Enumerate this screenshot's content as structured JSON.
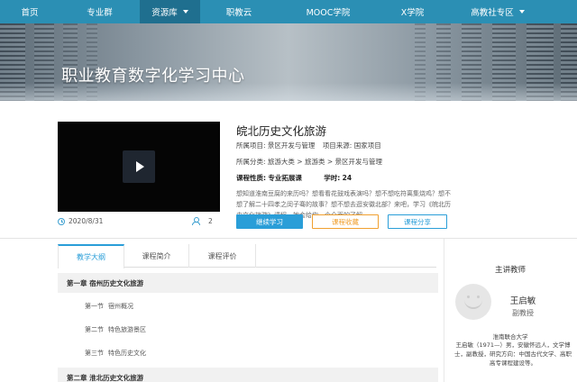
{
  "nav": {
    "items": [
      {
        "label": "首页",
        "dropdown": false
      },
      {
        "label": "专业群",
        "dropdown": false
      },
      {
        "label": "资源库",
        "dropdown": true
      },
      {
        "label": "职教云",
        "dropdown": false
      },
      {
        "label": "MOOC学院",
        "dropdown": false
      },
      {
        "label": "X学院",
        "dropdown": false
      },
      {
        "label": "高教社专区",
        "dropdown": true
      }
    ],
    "active_index": 2
  },
  "banner": {
    "title": "职业教育数字化学习中心"
  },
  "video": {
    "date": "2020/8/31",
    "learners": "2"
  },
  "course": {
    "title": "皖北历史文化旅游",
    "project_label": "所属项目:",
    "project": "景区开发与管理",
    "source_label": "项目来源:",
    "source": "国家项目",
    "category_label": "所属分类:",
    "category_path": "旅游大类 > 旅游类 > 景区开发与管理",
    "nature_label": "课程性质:",
    "nature": "专业拓展课",
    "hours_label": "学时:",
    "hours": "24",
    "description": "想知道淮南豆腐的来历吗？想看看花鼓戏表演吗？想不想吃符离集烧鸡？想不想了解二十四孝之闵子骞的故事？想不想去逛安徽北部？来吧，学习《皖北历史文化旅游》课程，她会给你一个全面的了解。"
  },
  "actions": {
    "study": "继续学习",
    "favorite": "课程收藏",
    "share": "课程分享"
  },
  "tabs": [
    {
      "label": "教学大纲",
      "active": true
    },
    {
      "label": "课程简介",
      "active": false
    },
    {
      "label": "课程评价",
      "active": false
    }
  ],
  "syllabus": {
    "chapter1": {
      "title": "第一章 宿州历史文化旅游",
      "sections": [
        {
          "num": "第一节",
          "name": "宿州概况"
        },
        {
          "num": "第二节",
          "name": "特色旅游景区"
        },
        {
          "num": "第三节",
          "name": "特色历史文化"
        }
      ]
    },
    "chapter2": {
      "title": "第二章 淮北历史文化旅游"
    }
  },
  "teacher": {
    "section_title": "主讲教师",
    "name": "王启敏",
    "title": "副教授",
    "org": "淮南联合大学",
    "bio": "王启敏（1971—）男，安徽怀远人，文学博士，副教授，研究方向：中国古代文学、高职高专课程建设等。"
  },
  "colors": {
    "nav": "#2b8fb4",
    "nav_active": "#1f6f8f",
    "primary": "#2a9ed8",
    "favorite": "#f0a030"
  }
}
